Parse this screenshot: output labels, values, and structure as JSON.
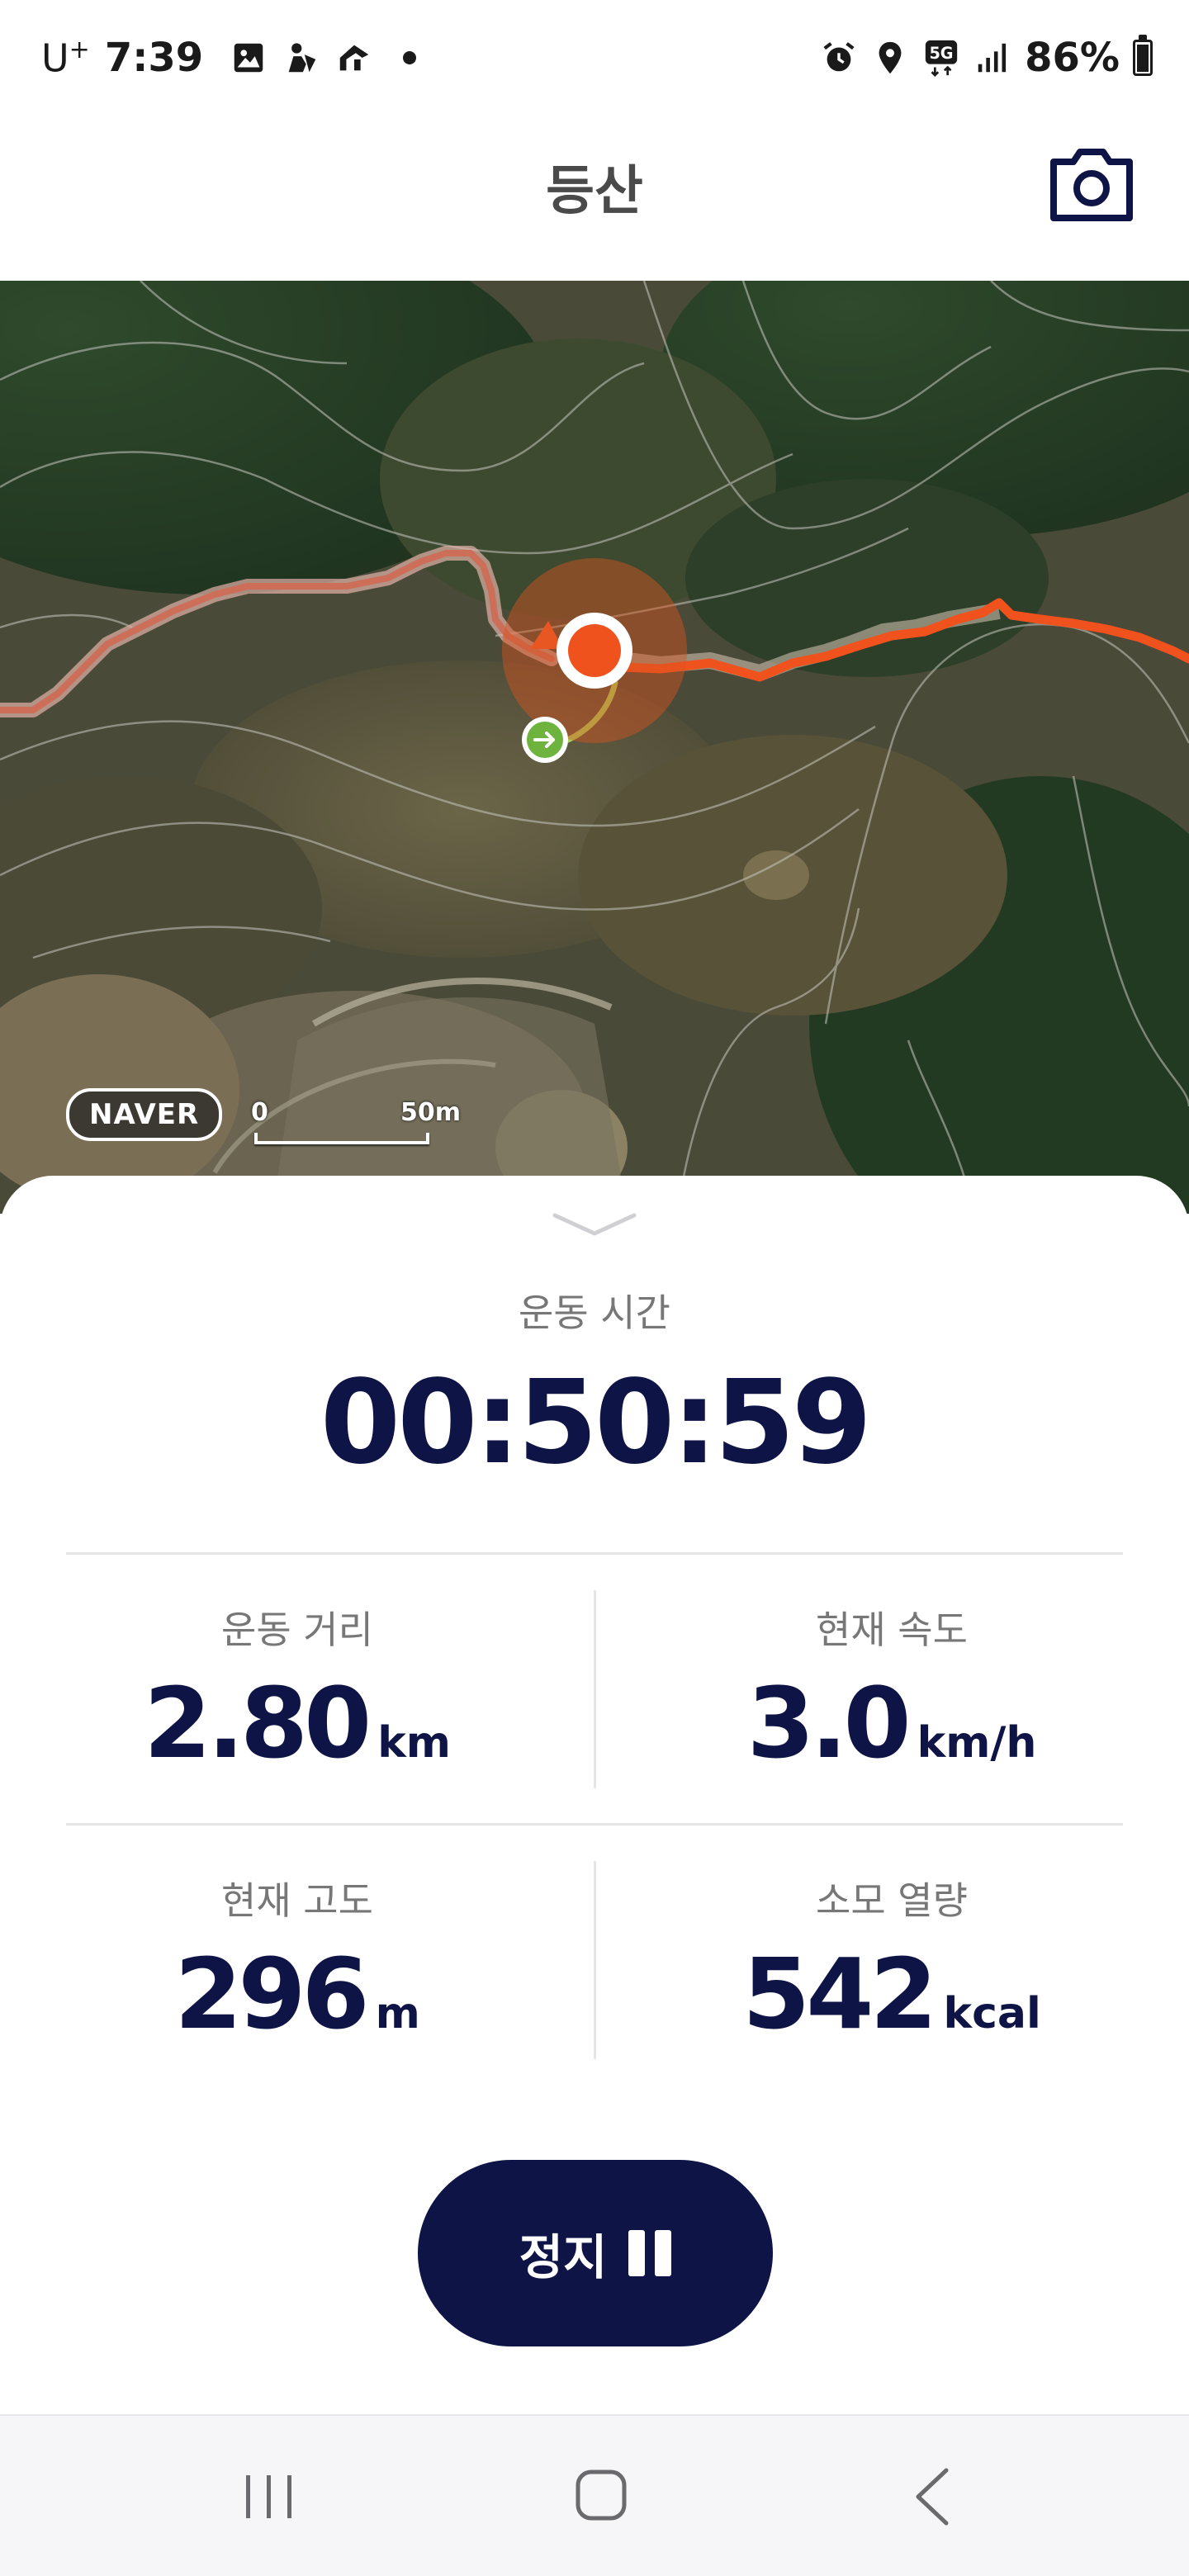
{
  "status_bar": {
    "carrier": "U",
    "carrier_sup": "+",
    "time": "7:39",
    "left_icons": [
      "gallery-icon",
      "navigation-app-icon",
      "route-app-icon"
    ],
    "right_icons": [
      "alarm-icon",
      "location-icon",
      "5g-icon",
      "signal-icon"
    ],
    "network": "5G",
    "battery_percent": "86%",
    "battery_level": 0.86
  },
  "header": {
    "title": "등산",
    "camera_icon": "camera-icon"
  },
  "map": {
    "provider_logo": "NAVER",
    "scale_start": "0",
    "scale_end": "50m",
    "colors": {
      "route_active": "#f0521e",
      "route_past": "#e27b6b",
      "start_marker": "#7cc04f"
    }
  },
  "stats": {
    "time_label": "운동 시간",
    "time_value": "00:50:59",
    "distance": {
      "label": "운동 거리",
      "value": "2.80",
      "unit": "km"
    },
    "speed": {
      "label": "현재 속도",
      "value": "3.0",
      "unit": "km/h"
    },
    "altitude": {
      "label": "현재 고도",
      "value": "296",
      "unit": "m"
    },
    "calories": {
      "label": "소모 열량",
      "value": "542",
      "unit": "kcal"
    }
  },
  "controls": {
    "pause_label": "정지",
    "pause_icon": "pause-icon"
  },
  "nav": {
    "items": [
      "recent-apps-icon",
      "home-icon",
      "back-icon"
    ]
  },
  "theme": {
    "primary": "#0f1446",
    "label_gray": "#777777"
  }
}
